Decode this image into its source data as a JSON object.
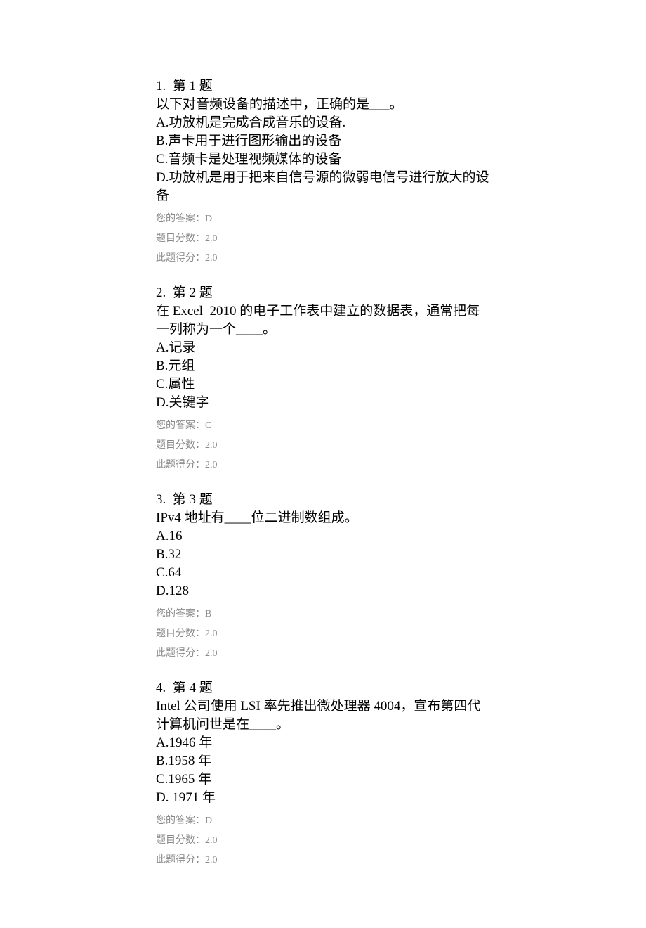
{
  "labels": {
    "answer_prefix": "您的答案：",
    "score_prefix": "题目分数：",
    "got_prefix": "此题得分："
  },
  "questions": [
    {
      "header": "1.  第 1 题",
      "stem_lines": [
        "以下对音频设备的描述中，正确的是___。"
      ],
      "options": [
        "A.功放机是完成合成音乐的设备.",
        "B.声卡用于进行图形输出的设备",
        "C.音频卡是处理视频媒体的设备",
        "D.功放机是用于把来自信号源的微弱电信号进行放大的设备"
      ],
      "answer": "D",
      "max_score": "2.0",
      "got_score": "2.0"
    },
    {
      "header": "2.  第 2 题",
      "stem_lines": [
        "在 Excel  2010 的电子工作表中建立的数据表，通常把每一列称为一个____。"
      ],
      "options": [
        "A.记录",
        "B.元组",
        "C.属性",
        "D.关键字"
      ],
      "answer": "C",
      "max_score": "2.0",
      "got_score": "2.0"
    },
    {
      "header": "3.  第 3 题",
      "stem_lines": [
        "IPv4 地址有____位二进制数组成。"
      ],
      "options": [
        "A.16",
        "B.32",
        "C.64",
        "D.128"
      ],
      "answer": "B",
      "max_score": "2.0",
      "got_score": "2.0"
    },
    {
      "header": "4.  第 4 题",
      "stem_lines": [
        "Intel 公司使用 LSI 率先推出微处理器 4004，宣布第四代计算机问世是在____。"
      ],
      "options": [
        "A.1946 年",
        "B.1958 年",
        "C.1965 年",
        "D. 1971 年"
      ],
      "answer": "D",
      "max_score": "2.0",
      "got_score": "2.0"
    }
  ]
}
